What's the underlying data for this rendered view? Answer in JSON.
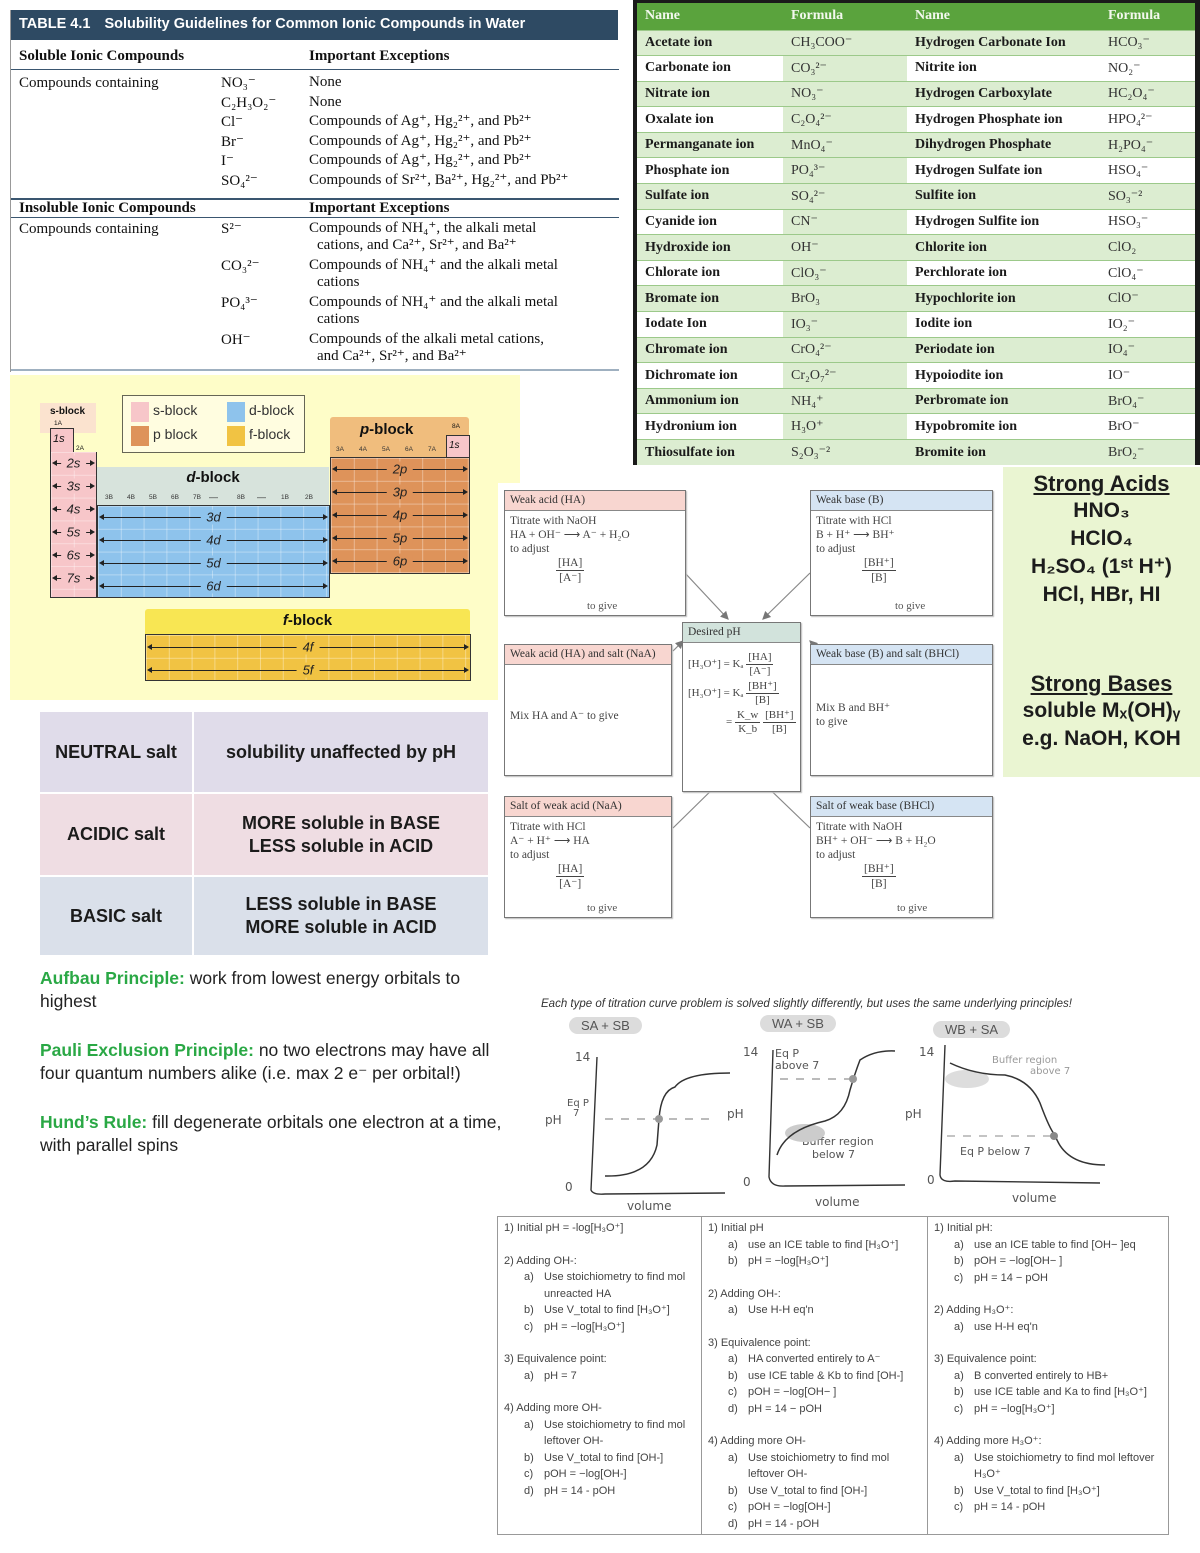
{
  "solubility_table": {
    "number": "TABLE 4.1",
    "title": "Solubility Guidelines for Common Ionic Compounds in Water",
    "soluble_header": "Soluble Ionic Compounds",
    "insoluble_header": "Insoluble Ionic Compounds",
    "exceptions_header": "Important Exceptions",
    "row_label": "Compounds containing",
    "soluble_rows": [
      {
        "ion": "NO₃⁻",
        "exceptions": [
          "None"
        ]
      },
      {
        "ion": "C₂H₃O₂⁻",
        "exceptions": [
          "None"
        ]
      },
      {
        "ion": "Cl⁻",
        "exceptions": [
          "Compounds of Ag⁺, Hg₂²⁺, and Pb²⁺"
        ]
      },
      {
        "ion": "Br⁻",
        "exceptions": [
          "Compounds of Ag⁺, Hg₂²⁺, and Pb²⁺"
        ]
      },
      {
        "ion": "I⁻",
        "exceptions": [
          "Compounds of Ag⁺, Hg₂²⁺, and Pb²⁺"
        ]
      },
      {
        "ion": "SO₄²⁻",
        "exceptions": [
          "Compounds of Sr²⁺, Ba²⁺, Hg₂²⁺, and Pb²⁺"
        ]
      }
    ],
    "insoluble_rows": [
      {
        "ion": "S²⁻",
        "exceptions": [
          "Compounds of NH₄⁺, the alkali metal",
          "cations, and Ca²⁺, Sr²⁺, and Ba²⁺"
        ]
      },
      {
        "ion": "CO₃²⁻",
        "exceptions": [
          "Compounds of NH₄⁺ and the alkali metal",
          "cations"
        ]
      },
      {
        "ion": "PO₄³⁻",
        "exceptions": [
          "Compounds of NH₄⁺ and the alkali metal",
          "cations"
        ]
      },
      {
        "ion": "OH⁻",
        "exceptions": [
          "Compounds of the alkali metal cations,",
          "and Ca²⁺, Sr²⁺, and Ba²⁺"
        ]
      }
    ]
  },
  "ion_table": {
    "headers": [
      "Name",
      "Formula",
      "Name",
      "Formula"
    ],
    "rows": [
      [
        "Acetate ion",
        "CH₃COO⁻",
        "Hydrogen Carbonate Ion",
        "HCO₃⁻"
      ],
      [
        "Carbonate ion",
        "CO₃²⁻",
        "Nitrite ion",
        "NO₂⁻"
      ],
      [
        "Nitrate ion",
        "NO₃⁻",
        "Hydrogen Carboxylate",
        "HC₂O₄⁻"
      ],
      [
        "Oxalate ion",
        "C₂O₄²⁻",
        "Hydrogen Phosphate ion",
        "HPO₄²⁻"
      ],
      [
        "Permanganate  ion",
        "MnO₄⁻",
        "Dihydrogen Phosphate",
        "H₂PO₄⁻"
      ],
      [
        "Phosphate ion",
        "PO₄³⁻",
        "Hydrogen Sulfate ion",
        "HSO₄⁻"
      ],
      [
        "Sulfate ion",
        "SO₄²⁻",
        "Sulfite ion",
        "SO₃⁻²"
      ],
      [
        "Cyanide ion",
        "CN⁻",
        "Hydrogen Sulfite ion",
        "HSO₃⁻"
      ],
      [
        "Hydroxide ion",
        "OH⁻",
        "Chlorite ion",
        "ClO₂"
      ],
      [
        "Chlorate ion",
        "ClO₃⁻",
        "Perchlorate ion",
        "ClO₄⁻"
      ],
      [
        "Bromate ion",
        "BrO₃",
        "Hypochlorite ion",
        "ClO⁻"
      ],
      [
        "Iodate Ion",
        "IO₃⁻",
        "Iodite ion",
        "IO₂⁻"
      ],
      [
        "Chromate ion",
        "CrO₄²⁻",
        "Periodate ion",
        "IO₄⁻"
      ],
      [
        "Dichromate ion",
        "Cr₂O₇²⁻",
        "Hypoiodite ion",
        "IO⁻"
      ],
      [
        "Ammonium ion",
        "NH₄⁺",
        "Perbromate ion",
        "BrO₄⁻"
      ],
      [
        "Hydronium ion",
        "H₃O⁺",
        "Hypobromite ion",
        "BrO⁻"
      ],
      [
        "Thiosulfate ion",
        "S₂O₃⁻²",
        "Bromite ion",
        "BrO₂⁻"
      ]
    ],
    "colors": {
      "header": "#5aa33d",
      "band": "#dcedd1",
      "frame": "#1a1a1a"
    }
  },
  "periodic_blocks": {
    "legend": [
      {
        "label": "s-block",
        "color": "#f7c6c9"
      },
      {
        "label": "d-block",
        "color": "#8ec3ec"
      },
      {
        "label": "p block",
        "color": "#de935a"
      },
      {
        "label": "f-block",
        "color": "#f1c343"
      }
    ],
    "s_block": {
      "title": "s-block",
      "groups": [
        "1A",
        "2A"
      ],
      "orbitals": [
        "1s",
        "2s",
        "3s",
        "4s",
        "5s",
        "6s",
        "7s"
      ]
    },
    "d_block": {
      "title": "d-block",
      "groups": [
        "3B",
        "4B",
        "5B",
        "6B",
        "7B",
        "8B",
        "1B",
        "2B"
      ],
      "orbitals": [
        "3d",
        "4d",
        "5d",
        "6d"
      ]
    },
    "p_block": {
      "title": "p-block",
      "groups": [
        "3A",
        "4A",
        "5A",
        "6A",
        "7A",
        "8A"
      ],
      "orbitals": [
        "2p",
        "3p",
        "4p",
        "5p",
        "6p"
      ],
      "helium": "1s"
    },
    "f_block": {
      "title": "f-block",
      "orbitals": [
        "4f",
        "5f"
      ]
    }
  },
  "buffer_diagram": {
    "center": {
      "title": "Desired pH",
      "eq1_lhs": "[H₃O⁺] = Kₐ",
      "eq1_num": "[HA]",
      "eq1_den": "[A⁻]",
      "eq2_lhs": "[H₃O⁺] = Kₐ",
      "eq2_num": "[BH⁺]",
      "eq2_den": "[B]",
      "eq3_lhs": "=",
      "eq3_k_num": "K_w",
      "eq3_k_den": "K_b",
      "eq3_num": "[BH⁺]",
      "eq3_den": "[B]"
    },
    "weak_acid": {
      "title": "Weak acid (HA)",
      "l1": "Titrate with NaOH",
      "l2": "HA + OH⁻  ⟶  A⁻ + H₂O",
      "l3": "to adjust",
      "num": "[HA]",
      "den": "[A⁻]",
      "give": "to give"
    },
    "weak_base": {
      "title": "Weak base (B)",
      "l1": "Titrate with HCl",
      "l2": "B + H⁺  ⟶  BH⁺",
      "l3": "to adjust",
      "num": "[BH⁺]",
      "den": "[B]",
      "give": "to give"
    },
    "acid_salt": {
      "title": "Weak acid (HA) and salt (NaA)",
      "l1": "Mix HA and A⁻ to give"
    },
    "base_salt": {
      "title": "Weak base (B) and salt (BHCl)",
      "l1": "Mix B and BH⁺",
      "l2": "to give"
    },
    "salt_weak_acid": {
      "title": "Salt of weak acid (NaA)",
      "l1": "Titrate with HCl",
      "l2": "A⁻ + H⁺  ⟶  HA",
      "l3": "to adjust",
      "num": "[HA]",
      "den": "[A⁻]",
      "give": "to give"
    },
    "salt_weak_base": {
      "title": "Salt of weak base (BHCl)",
      "l1": "Titrate with NaOH",
      "l2": "BH⁺ + OH⁻  ⟶  B + H₂O",
      "l3": "to adjust",
      "num": "[BH⁺]",
      "den": "[B]",
      "give": "to give"
    }
  },
  "strong": {
    "acids_title": "Strong Acids",
    "acids": [
      "HNO₃",
      "HClO₄",
      "H₂SO₄ (1ˢᵗ H⁺)",
      "HCl, HBr, HI"
    ],
    "bases_title": "Strong Bases",
    "bases": [
      "soluble Mₓ(OH)ᵧ",
      "e.g. NaOH, KOH"
    ]
  },
  "salts": [
    {
      "type": "NEUTRAL salt",
      "effect": [
        "solubility unaffected by pH"
      ],
      "color": "#e0dcea"
    },
    {
      "type": "ACIDIC salt",
      "effect": [
        "MORE soluble in BASE",
        "LESS soluble in ACID"
      ],
      "color": "#efdde3"
    },
    {
      "type": "BASIC salt",
      "effect": [
        "LESS soluble in BASE",
        "MORE soluble in ACID"
      ],
      "color": "#dae0ea"
    }
  ],
  "principles": [
    {
      "term": "Aufbau Principle:",
      "text": " work from lowest energy orbitals to highest"
    },
    {
      "term": "Pauli Exclusion Principle:",
      "text": " no two electrons may have all four quantum numbers alike (i.e. max 2 e⁻ per orbital!)"
    },
    {
      "term": "Hund’s Rule:",
      "text": " fill degenerate orbitals one electron at a time, with parallel spins"
    }
  ],
  "titration_curves": {
    "caption": "Each type of titration curve problem is solved slightly differently, but uses the same underlying principles!",
    "panels": [
      {
        "title": "SA + SB",
        "ymax": "14",
        "ymin": "0",
        "ylabel": "pH",
        "xlabel": "volume",
        "note1": "Eq P",
        "note2": "7"
      },
      {
        "title": "WA + SB",
        "ymax": "14",
        "ymin": "0",
        "ylabel": "pH",
        "xlabel": "volume",
        "note1": "Eq P",
        "note2": "above 7",
        "note3": "Buffer region",
        "note4": "below 7"
      },
      {
        "title": "WB + SA",
        "ymax": "14",
        "ymin": "0",
        "ylabel": "pH",
        "xlabel": "volume",
        "note1": "Buffer region",
        "note2": "above 7",
        "note3": "Eq P below 7"
      }
    ]
  },
  "steps": {
    "sa_sb": [
      {
        "h": "1) Initial pH = -log[H₃O⁺]",
        "items": []
      },
      {
        "h": "2) Adding OH-:",
        "items": [
          [
            "a)",
            "Use stoichiometry to find mol unreacted HA"
          ],
          [
            "b)",
            "Use V_total to find [H₃O⁺]"
          ],
          [
            "c)",
            "pH = −log[H₃O⁺]"
          ]
        ]
      },
      {
        "h": "3) Equivalence point:",
        "items": [
          [
            "a)",
            "pH = 7"
          ]
        ]
      },
      {
        "h": "4) Adding more OH-",
        "items": [
          [
            "a)",
            "Use stoichiometry to find mol leftover OH-"
          ],
          [
            "b)",
            "Use V_total to find [OH-]"
          ],
          [
            "c)",
            "pOH = −log[OH-]"
          ],
          [
            "d)",
            "pH = 14 - pOH"
          ]
        ]
      }
    ],
    "wa_sb": [
      {
        "h": "1) Initial pH",
        "items": [
          [
            "a)",
            "use an ICE table to find [H₃O⁺]"
          ],
          [
            "b)",
            "pH = −log[H₃O⁺]"
          ]
        ]
      },
      {
        "h": "2) Adding OH-:",
        "items": [
          [
            "a)",
            "Use H-H eq'n"
          ]
        ]
      },
      {
        "h": "3) Equivalence point:",
        "items": [
          [
            "a)",
            "HA converted entirely to A⁻"
          ],
          [
            "b)",
            "use ICE table & Kb to find [OH-]"
          ],
          [
            "c)",
            "pOH = −log[OH− ]"
          ],
          [
            "d)",
            "pH = 14 − pOH"
          ]
        ]
      },
      {
        "h": "4) Adding more OH-",
        "items": [
          [
            "a)",
            "Use stoichiometry to find mol leftover OH-"
          ],
          [
            "b)",
            "Use V_total to find [OH-]"
          ],
          [
            "c)",
            "pOH = −log[OH-]"
          ],
          [
            "d)",
            "pH = 14 - pOH"
          ]
        ]
      }
    ],
    "wb_sa": [
      {
        "h": "1) Initial pH:",
        "items": [
          [
            "a)",
            "use an ICE table to find [OH− ]eq"
          ],
          [
            "b)",
            "pOH = −log[OH− ]"
          ],
          [
            "c)",
            "pH = 14 − pOH"
          ]
        ]
      },
      {
        "h": "2) Adding H₃O⁺:",
        "items": [
          [
            "a)",
            "use H-H eq'n"
          ]
        ]
      },
      {
        "h": "3) Equivalence point:",
        "items": [
          [
            "a)",
            "B converted entirely to HB+"
          ],
          [
            "b)",
            "use ICE table and Ka to find [H₃O⁺]"
          ],
          [
            "c)",
            "pH = −log[H₃O⁺]"
          ]
        ]
      },
      {
        "h": "4) Adding more H₃O⁺:",
        "items": [
          [
            "a)",
            "Use stoichiometry to find mol leftover H₃O⁺"
          ],
          [
            "b)",
            "Use V_total to find [H₃O⁺]"
          ],
          [
            "c)",
            "pH = 14 - pOH"
          ]
        ]
      }
    ]
  }
}
